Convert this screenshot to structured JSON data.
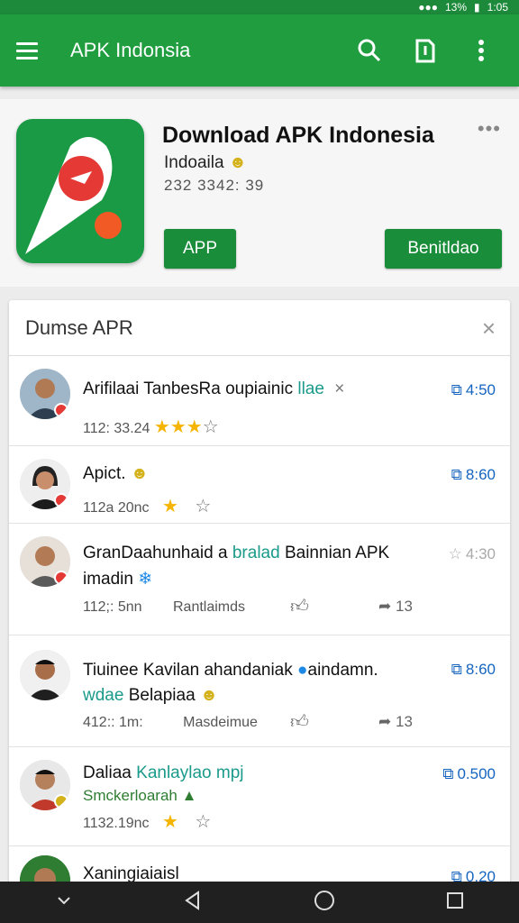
{
  "status": {
    "signal": "···",
    "battery": "13%",
    "time": "1:05"
  },
  "appbar": {
    "title": "APK Indonsia"
  },
  "hero": {
    "title": "Download APK Indonesia",
    "developer": "Indoaila",
    "meta": "232 3342: 39",
    "more": "•••",
    "btn_app": "APP",
    "btn_right": "Benitldao"
  },
  "card": {
    "title": "Dumse APR",
    "close": "×",
    "rows": [
      {
        "title": "Arifilaai TanbesRa oupiainic",
        "title_tail": "llae",
        "sub": "112: 33.24",
        "action": "4:50",
        "extra": "×"
      },
      {
        "title": "Apict.",
        "sub": "112a 20nc",
        "action": "8:60"
      },
      {
        "title": "GranDaahunhaid a",
        "title_mid": "bralad",
        "title_tail": "Bainnian APK",
        "line2": "imadin",
        "sub": "112;: 5nn",
        "sub2": "Rantlaimds",
        "count": "13",
        "action": "4:30"
      },
      {
        "title": "Tiuinee Kavilan ahandaniak",
        "title_tail": "aindamn.",
        "line2_a": "wdae",
        "line2_b": "Belapiaa",
        "sub": "412:: 1m:",
        "sub2": "Masdeimue",
        "count": "13",
        "action": "8:60"
      },
      {
        "title": "Daliaa",
        "title_tail": "Kanlaylao mpj",
        "line2": "Smckerloarah",
        "sub": "1132.19nc",
        "action": "0.500"
      },
      {
        "title": "Xaningiaiaisl",
        "action": "0.20"
      }
    ]
  },
  "colors": {
    "primary": "#1f9d3f",
    "accent": "#1565c0",
    "star": "#f4b400"
  }
}
